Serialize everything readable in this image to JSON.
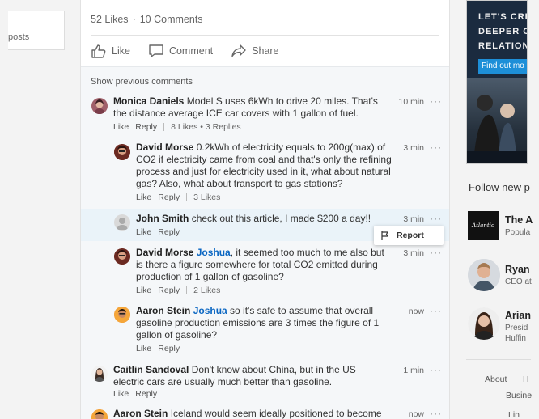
{
  "left_card": {
    "label": "posts"
  },
  "post": {
    "likes": "52 Likes",
    "separator": "·",
    "comments_count": "10 Comments",
    "actions": {
      "like": "Like",
      "comment": "Comment",
      "share": "Share"
    }
  },
  "comments_section": {
    "show_previous": "Show previous comments",
    "items": [
      {
        "author": "Monica Daniels",
        "text": "Model S uses 6kWh to drive 20 miles. That's the distance average ICE car covers with 1 gallon of fuel.",
        "time": "10 min",
        "like": "Like",
        "reply": "Reply",
        "stats": "8 Likes • 3 Replies"
      },
      {
        "author": "David Morse",
        "text": "0.2kWh of electricity equals to 200g(max) of CO2 if electricity came from coal and that's only the refining process and just for electricity used in it, what about natural gas? Also, what about transport to gas stations?",
        "time": "3 min",
        "like": "Like",
        "reply": "Reply",
        "stats": "3 Likes"
      },
      {
        "author": "John Smith",
        "text": "check out this article, I made $200 a day!!",
        "time": "3 min",
        "like": "Like",
        "reply": "Reply",
        "stats": ""
      },
      {
        "author": "David Morse",
        "mention": "Joshua",
        "text": ", it seemed too much to me also but is there a figure somewhere for total CO2 emitted during production of 1 gallon of gasoline?",
        "time": "3 min",
        "like": "Like",
        "reply": "Reply",
        "stats": "2 Likes"
      },
      {
        "author": "Aaron Stein",
        "mention": "Joshua",
        "text": " so it's safe to assume that overall gasoline production emissions are 3 times the figure of 1 gallon of gasoline?",
        "time": "now",
        "like": "Like",
        "reply": "Reply",
        "stats": ""
      },
      {
        "author": "Caitlin Sandoval",
        "text": "Don't know about China, but in the US electric cars are usually much better than gasoline.",
        "time": "1 min",
        "like": "Like",
        "reply": "Reply",
        "stats": ""
      },
      {
        "author": "Aaron Stein",
        "text": "Iceland would seem ideally positioned to become",
        "time": "now"
      }
    ],
    "more_glyph": "···",
    "report_label": "Report"
  },
  "ad": {
    "lines": [
      "LET'S CREA",
      "DEEPER CU",
      "RELATION"
    ],
    "button": "Find out mo"
  },
  "follow": {
    "title": "Follow new p",
    "suggestions": [
      {
        "name": "The A",
        "sub": "Popula",
        "logo_text": "Atlantic"
      },
      {
        "name": "Ryan",
        "sub": "CEO at"
      },
      {
        "name": "Arian",
        "sub": "Presid",
        "sub2": "Huffin"
      }
    ]
  },
  "footer": {
    "about": "About",
    "h": "H",
    "business": "Busine",
    "cut": "Lin"
  },
  "colors": {
    "accent": "#0a66c2",
    "highlight": "#eaf3f9",
    "ad_bg": "#1b2b3f",
    "ad_button": "#1d8fd8"
  }
}
